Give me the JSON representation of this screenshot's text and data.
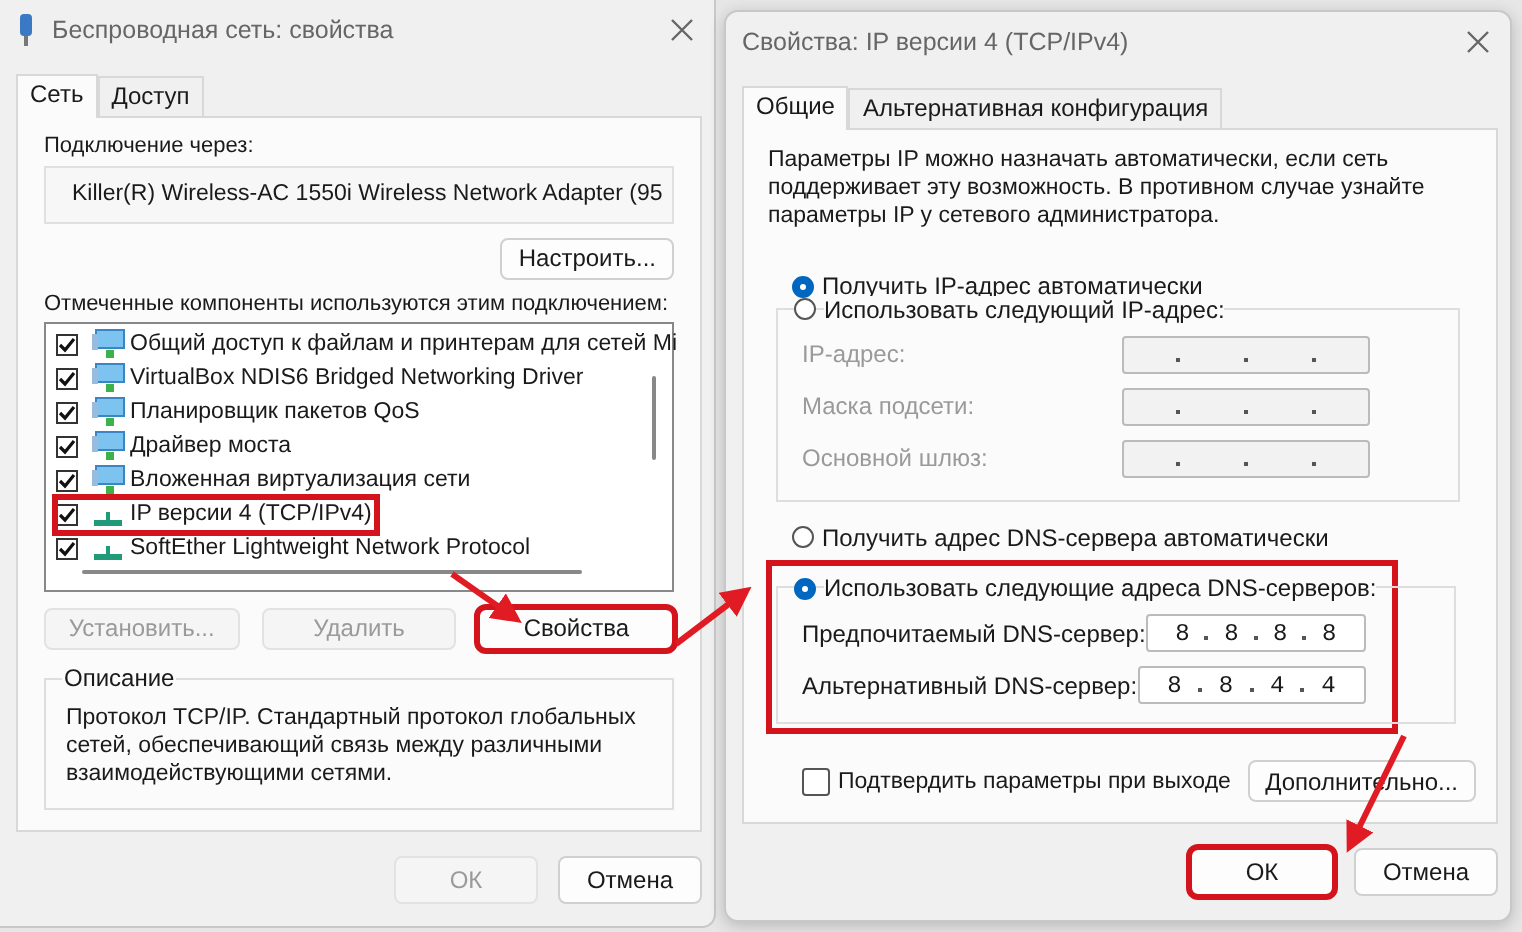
{
  "network_properties": {
    "title": "Беспроводная сеть: свойства",
    "tabs": [
      {
        "label": "Сеть",
        "selected": true
      },
      {
        "label": "Доступ",
        "selected": false
      }
    ],
    "connect_via_label": "Подключение через:",
    "adapter_name": "Killer(R) Wireless-AC 1550i Wireless Network Adapter (95",
    "configure_button": "Настроить...",
    "components_label": "Отмеченные компоненты используются этим подключением:",
    "components": [
      {
        "name": "Общий доступ к файлам и принтерам для сетей Mi",
        "kind": "service",
        "checked": true,
        "highlighted": false
      },
      {
        "name": "VirtualBox NDIS6 Bridged Networking Driver",
        "kind": "service",
        "checked": true,
        "highlighted": false
      },
      {
        "name": "Планировщик пакетов QoS",
        "kind": "service",
        "checked": true,
        "highlighted": false
      },
      {
        "name": "Драйвер моста",
        "kind": "service",
        "checked": true,
        "highlighted": false
      },
      {
        "name": "Вложенная виртуализация сети",
        "kind": "service",
        "checked": true,
        "highlighted": false
      },
      {
        "name": "IP версии 4 (TCP/IPv4)",
        "kind": "protocol",
        "checked": true,
        "highlighted": true
      },
      {
        "name": "SoftEther Lightweight Network Protocol",
        "kind": "protocol",
        "checked": true,
        "highlighted": false
      }
    ],
    "buttons": [
      {
        "label": "Установить...",
        "disabled": true,
        "highlighted": false
      },
      {
        "label": "Удалить",
        "disabled": true,
        "highlighted": false
      },
      {
        "label": "Свойства",
        "disabled": false,
        "highlighted": true
      }
    ],
    "description": {
      "title": "Описание",
      "text": "Протокол TCP/IP. Стандартный протокол глобальных сетей, обеспечивающий связь между различными взаимодействующими сетями."
    },
    "footer_buttons": [
      {
        "label": "ОК",
        "disabled": true,
        "highlighted": false
      },
      {
        "label": "Отмена",
        "disabled": false,
        "highlighted": false
      }
    ]
  },
  "ipv4_properties": {
    "title": "Свойства: IP версии 4 (TCP/IPv4)",
    "tabs": [
      {
        "label": "Общие",
        "selected": true
      },
      {
        "label": "Альтернативная конфигурация",
        "selected": false
      }
    ],
    "intro": "Параметры IP можно назначать автоматически, если сеть поддерживает эту возможность. В противном случае узнайте параметры IP у сетевого администратора.",
    "ip_options": [
      {
        "label": "Получить IP-адрес автоматически",
        "selected": true
      },
      {
        "label": "Использовать следующий IP-адрес:",
        "selected": false
      }
    ],
    "ip_fields": [
      {
        "label": "IP-адрес:",
        "disabled": true
      },
      {
        "label": "Маска подсети:",
        "disabled": true
      },
      {
        "label": "Основной шлюз:",
        "disabled": true
      }
    ],
    "dns_options": [
      {
        "label": "Получить адрес DNS-сервера автоматически",
        "selected": false
      },
      {
        "label": "Использовать следующие адреса DNS-серверов:",
        "selected": true
      }
    ],
    "dns_highlighted": true,
    "dns_fields": [
      {
        "label": "Предпочитаемый DNS-сервер:",
        "octets": [
          "8",
          "8",
          "8",
          "8"
        ],
        "disabled": false
      },
      {
        "label": "Альтернативный DNS-сервер:",
        "octets": [
          "8",
          "8",
          "4",
          "4"
        ],
        "disabled": false
      }
    ],
    "confirm_checkbox": {
      "label": "Подтвердить параметры при выходе",
      "checked": false
    },
    "advanced_button": "Дополнительно...",
    "footer_buttons": [
      {
        "label": "ОК",
        "disabled": false,
        "highlighted": true
      },
      {
        "label": "Отмена",
        "disabled": false,
        "highlighted": false
      }
    ]
  }
}
